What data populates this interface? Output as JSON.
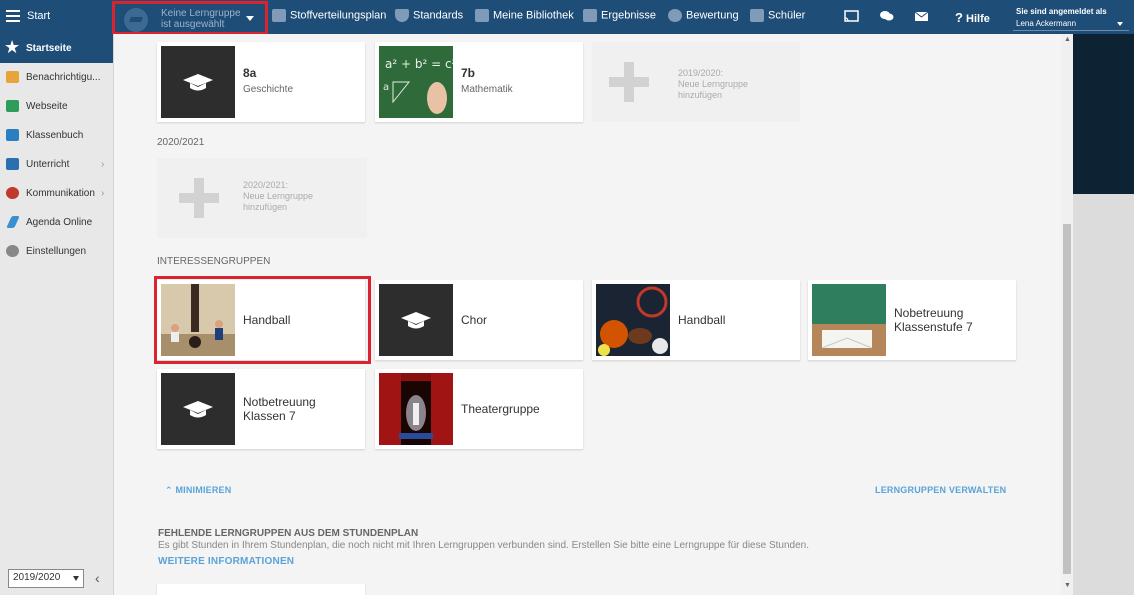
{
  "topbar": {
    "start_label": "Start",
    "group_select_line1": "Keine Lerngruppe",
    "group_select_line2": "ist ausgewählt",
    "nav": [
      {
        "label": "Stoffverteilungsplan",
        "icon": "calendar-icon"
      },
      {
        "label": "Standards",
        "icon": "shield-icon"
      },
      {
        "label": "Meine Bibliothek",
        "icon": "library-icon"
      },
      {
        "label": "Ergebnisse",
        "icon": "bar-chart-icon"
      },
      {
        "label": "Bewertung",
        "icon": "rating-icon"
      },
      {
        "label": "Schüler",
        "icon": "students-icon"
      }
    ],
    "help_label": "Hilfe",
    "user_line1": "Sie sind angemeldet als",
    "user_line2": "Lena Ackermann"
  },
  "sidebar": {
    "items": [
      {
        "label": "Startseite",
        "icon": "star-icon",
        "color": "#ffffff"
      },
      {
        "label": "Benachrichtigu...",
        "icon": "envelope-icon",
        "color": "#e8a33a"
      },
      {
        "label": "Webseite",
        "icon": "house-icon",
        "color": "#2e9c5a"
      },
      {
        "label": "Klassenbuch",
        "icon": "book-icon",
        "color": "#2a7fc0"
      },
      {
        "label": "Unterricht",
        "icon": "classroom-icon",
        "color": "#2a6fb0"
      },
      {
        "label": "Kommunikation",
        "icon": "chat-icon",
        "color": "#c0392b"
      },
      {
        "label": "Agenda Online",
        "icon": "pencil-icon",
        "color": "#3a8fd0"
      },
      {
        "label": "Einstellungen",
        "icon": "gear-icon",
        "color": "#888888"
      }
    ],
    "year_select": "2019/2020"
  },
  "main": {
    "groups_2019": [
      {
        "title": "8a",
        "sub": "Geschichte",
        "thumb": "graduation-cap-icon"
      },
      {
        "title": "7b",
        "sub": "Mathematik",
        "thumb": "chalkboard-photo"
      }
    ],
    "add_2019": {
      "line1": "2019/2020:",
      "line2": "Neue Lerngruppe",
      "line3": "hinzufügen"
    },
    "year_2020_label": "2020/2021",
    "add_2020": {
      "line1": "2020/2021:",
      "line2": "Neue Lerngruppe",
      "line3": "hinzufügen"
    },
    "interest_label": "INTERESSENGRUPPEN",
    "interest_groups": [
      {
        "title": "Handball",
        "thumb": "gym-photo"
      },
      {
        "title": "Chor",
        "thumb": "graduation-cap-icon"
      },
      {
        "title": "Handball",
        "thumb": "sports-balls-photo"
      },
      {
        "title": "Nobetreuung Klassenstufe 7",
        "thumb": "classroom-photo"
      },
      {
        "title": "Notbetreuung Klassen 7",
        "thumb": "graduation-cap-icon"
      },
      {
        "title": "Theatergruppe",
        "thumb": "theater-photo"
      }
    ],
    "minimize_label": "MINIMIEREN",
    "manage_label": "LERNGRUPPEN VERWALTEN",
    "missing_heading": "FEHLENDE LERNGRUPPEN AUS DEM STUNDENPLAN",
    "missing_desc": "Es gibt Stunden in Ihrem Stundenplan, die noch nicht mit Ihren Lerngruppen verbunden sind. Erstellen Sie bitte eine Lerngruppe für diese Stunden.",
    "more_info_label": "WEITERE INFORMATIONEN"
  },
  "colors": {
    "topbar": "#1e4d78",
    "highlight": "#d9232e",
    "link": "#5aa3d8"
  }
}
